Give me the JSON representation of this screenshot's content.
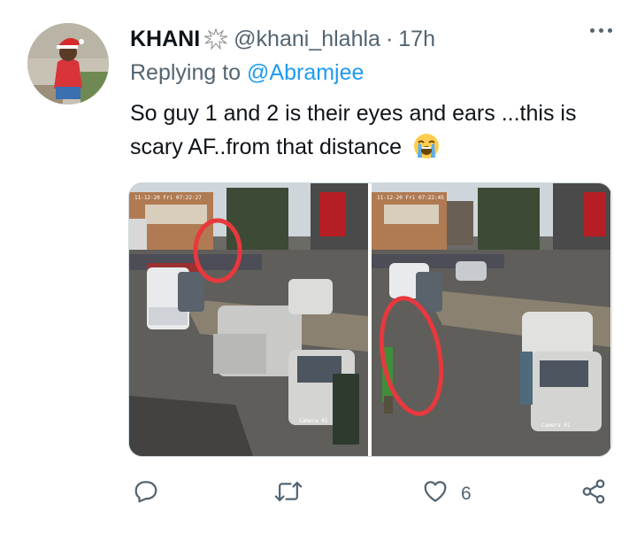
{
  "tweet": {
    "display_name": "KHANI",
    "handle": "@khani_hlahla",
    "separator": "·",
    "time": "17h",
    "reply_prefix": "Replying to",
    "reply_to": "@Abramjee",
    "text": "So guy 1 and 2 is their eyes and ears ...this is scary AF..from that distance",
    "emoji": "loudly-crying-face",
    "media_timestamps": [
      "11-12-20 Fri 07:22:27",
      "11-12-20 Fri 07:22:45"
    ],
    "camera_labels": [
      "Camera 01",
      "Camera 01"
    ]
  },
  "actions": {
    "reply_icon": "speech-bubble-icon",
    "retweet_icon": "retweet-icon",
    "like_icon": "heart-icon",
    "like_count": "6",
    "share_icon": "share-icon"
  },
  "colors": {
    "text": "#0f1419",
    "muted": "#536471",
    "link": "#1d9bf0",
    "annotation_circle": "#e8383d"
  }
}
